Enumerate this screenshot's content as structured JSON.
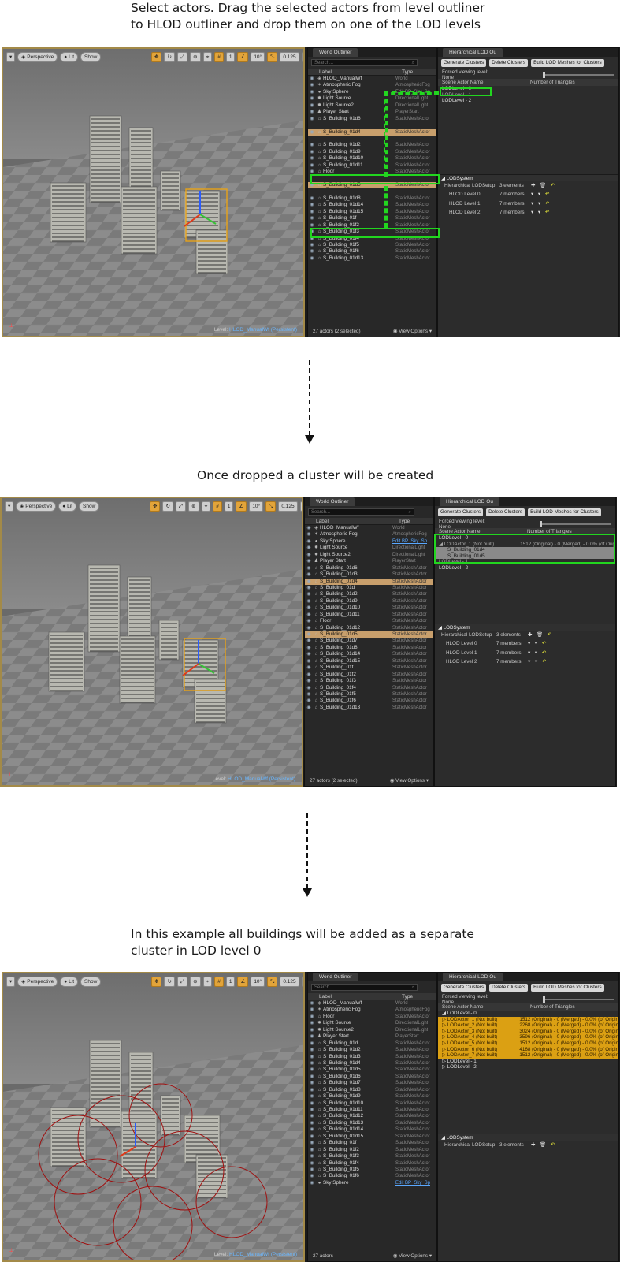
{
  "captions": {
    "step1_line1": "Select actors. Drag the selected actors from level outliner",
    "step1_line2": "to HLOD outliner and drop them on one of the LOD levels",
    "step2": "Once dropped a cluster will be created",
    "step3_line1": "In this example all buildings will be added as a separate",
    "step3_line2": "cluster in LOD level 0"
  },
  "viewport": {
    "perspective_label": "Perspective",
    "lit_label": "Lit",
    "show_label": "Show",
    "angle_value": "10°",
    "scale_value": "0.125",
    "camera_speed": "4",
    "level_prefix": "Level:",
    "level_name": "HLOD_ManualWf (Persistent)",
    "grid_value": "1"
  },
  "outliner": {
    "tab_title": "World Outliner",
    "search_placeholder": "Search...",
    "col_label": "Label",
    "col_type": "Type",
    "view_options": "View Options",
    "footer1": "27 actors (2 selected)",
    "footer2": "27 actors (2 selected)",
    "footer3": "27 actors",
    "rows1": [
      {
        "label": "HLOD_ManualWf",
        "type": "World",
        "icon": "◈",
        "sel": false
      },
      {
        "label": "Atmospheric Fog",
        "type": "AtmosphericFog",
        "icon": "✶",
        "sel": false
      },
      {
        "label": "Sky Sphere",
        "type": "Edit BP_Sky_Sp",
        "icon": "●",
        "sel": false
      },
      {
        "label": "Light Source",
        "type": "DirectionalLight",
        "icon": "✹",
        "sel": false
      },
      {
        "label": "Light Source2",
        "type": "DirectionalLight",
        "icon": "✹",
        "sel": false
      },
      {
        "label": "Player Start",
        "type": "PlayerStart",
        "icon": "♟",
        "sel": false
      },
      {
        "label": "S_Building_01d6",
        "type": "StaticMeshActor",
        "icon": "⌂",
        "sel": false
      },
      {
        "label": "",
        "type": "",
        "icon": "",
        "sel": false
      },
      {
        "label": "S_Building_01d4",
        "type": "StaticMeshActor",
        "icon": "⌂",
        "sel": true
      },
      {
        "label": "",
        "type": "",
        "icon": "",
        "sel": false
      },
      {
        "label": "S_Building_01d2",
        "type": "StaticMeshActor",
        "icon": "⌂",
        "sel": false
      },
      {
        "label": "S_Building_01d9",
        "type": "StaticMeshActor",
        "icon": "⌂",
        "sel": false
      },
      {
        "label": "S_Building_01d10",
        "type": "StaticMeshActor",
        "icon": "⌂",
        "sel": false
      },
      {
        "label": "S_Building_01d11",
        "type": "StaticMeshActor",
        "icon": "⌂",
        "sel": false
      },
      {
        "label": "Floor",
        "type": "StaticMeshActor",
        "icon": "⌂",
        "sel": false
      },
      {
        "label": "",
        "type": "",
        "icon": "",
        "sel": false
      },
      {
        "label": "S_Building_01d5",
        "type": "StaticMeshActor",
        "icon": "⌂",
        "sel": true
      },
      {
        "label": "",
        "type": "",
        "icon": "",
        "sel": false
      },
      {
        "label": "S_Building_01d8",
        "type": "StaticMeshActor",
        "icon": "⌂",
        "sel": false
      },
      {
        "label": "S_Building_01d14",
        "type": "StaticMeshActor",
        "icon": "⌂",
        "sel": false
      },
      {
        "label": "S_Building_01d15",
        "type": "StaticMeshActor",
        "icon": "⌂",
        "sel": false
      },
      {
        "label": "S_Building_01f",
        "type": "StaticMeshActor",
        "icon": "⌂",
        "sel": false
      },
      {
        "label": "S_Building_01f2",
        "type": "StaticMeshActor",
        "icon": "⌂",
        "sel": false
      },
      {
        "label": "S_Building_01f3",
        "type": "StaticMeshActor",
        "icon": "⌂",
        "sel": false
      },
      {
        "label": "S_Building_01f4",
        "type": "StaticMeshActor",
        "icon": "⌂",
        "sel": false
      },
      {
        "label": "S_Building_01f5",
        "type": "StaticMeshActor",
        "icon": "⌂",
        "sel": false
      },
      {
        "label": "S_Building_01f6",
        "type": "StaticMeshActor",
        "icon": "⌂",
        "sel": false
      },
      {
        "label": "S_Building_01d13",
        "type": "StaticMeshActor",
        "icon": "⌂",
        "sel": false
      }
    ],
    "rows2": [
      {
        "label": "HLOD_ManualWf",
        "type": "World",
        "icon": "◈",
        "sel": false
      },
      {
        "label": "Atmospheric Fog",
        "type": "AtmosphericFog",
        "icon": "✶",
        "sel": false
      },
      {
        "label": "Sky Sphere",
        "type": "Edit BP_Sky_Sp",
        "icon": "●",
        "sel": false,
        "link": true
      },
      {
        "label": "Light Source",
        "type": "DirectionalLight",
        "icon": "✹",
        "sel": false
      },
      {
        "label": "Light Source2",
        "type": "DirectionalLight",
        "icon": "✹",
        "sel": false
      },
      {
        "label": "Player Start",
        "type": "PlayerStart",
        "icon": "♟",
        "sel": false
      },
      {
        "label": "S_Building_01d6",
        "type": "StaticMeshActor",
        "icon": "⌂",
        "sel": false
      },
      {
        "label": "S_Building_01d3",
        "type": "StaticMeshActor",
        "icon": "⌂",
        "sel": false
      },
      {
        "label": "S_Building_01d4",
        "type": "StaticMeshActor",
        "icon": "⌂",
        "sel": true
      },
      {
        "label": "S_Building_01d",
        "type": "StaticMeshActor",
        "icon": "⌂",
        "sel": false
      },
      {
        "label": "S_Building_01d2",
        "type": "StaticMeshActor",
        "icon": "⌂",
        "sel": false
      },
      {
        "label": "S_Building_01d9",
        "type": "StaticMeshActor",
        "icon": "⌂",
        "sel": false
      },
      {
        "label": "S_Building_01d10",
        "type": "StaticMeshActor",
        "icon": "⌂",
        "sel": false
      },
      {
        "label": "S_Building_01d11",
        "type": "StaticMeshActor",
        "icon": "⌂",
        "sel": false
      },
      {
        "label": "Floor",
        "type": "StaticMeshActor",
        "icon": "⌂",
        "sel": false
      },
      {
        "label": "S_Building_01d12",
        "type": "StaticMeshActor",
        "icon": "⌂",
        "sel": false
      },
      {
        "label": "S_Building_01d5",
        "type": "StaticMeshActor",
        "icon": "⌂",
        "sel": true
      },
      {
        "label": "S_Building_01d7",
        "type": "StaticMeshActor",
        "icon": "⌂",
        "sel": false
      },
      {
        "label": "S_Building_01d8",
        "type": "StaticMeshActor",
        "icon": "⌂",
        "sel": false
      },
      {
        "label": "S_Building_01d14",
        "type": "StaticMeshActor",
        "icon": "⌂",
        "sel": false
      },
      {
        "label": "S_Building_01d15",
        "type": "StaticMeshActor",
        "icon": "⌂",
        "sel": false
      },
      {
        "label": "S_Building_01f",
        "type": "StaticMeshActor",
        "icon": "⌂",
        "sel": false
      },
      {
        "label": "S_Building_01f2",
        "type": "StaticMeshActor",
        "icon": "⌂",
        "sel": false
      },
      {
        "label": "S_Building_01f3",
        "type": "StaticMeshActor",
        "icon": "⌂",
        "sel": false
      },
      {
        "label": "S_Building_01f4",
        "type": "StaticMeshActor",
        "icon": "⌂",
        "sel": false
      },
      {
        "label": "S_Building_01f5",
        "type": "StaticMeshActor",
        "icon": "⌂",
        "sel": false
      },
      {
        "label": "S_Building_01f6",
        "type": "StaticMeshActor",
        "icon": "⌂",
        "sel": false
      },
      {
        "label": "S_Building_01d13",
        "type": "StaticMeshActor",
        "icon": "⌂",
        "sel": false
      }
    ],
    "rows3": [
      {
        "label": "HLOD_ManualWf",
        "type": "World",
        "icon": "◈",
        "sel": false
      },
      {
        "label": "Atmospheric Fog",
        "type": "AtmosphericFog",
        "icon": "✶",
        "sel": false
      },
      {
        "label": "Floor",
        "type": "StaticMeshActor",
        "icon": "⌂",
        "sel": false
      },
      {
        "label": "Light Source",
        "type": "DirectionalLight",
        "icon": "✹",
        "sel": false
      },
      {
        "label": "Light Source2",
        "type": "DirectionalLight",
        "icon": "✹",
        "sel": false
      },
      {
        "label": "Player Start",
        "type": "PlayerStart",
        "icon": "♟",
        "sel": false
      },
      {
        "label": "S_Building_01d",
        "type": "StaticMeshActor",
        "icon": "⌂",
        "sel": false
      },
      {
        "label": "S_Building_01d2",
        "type": "StaticMeshActor",
        "icon": "⌂",
        "sel": false
      },
      {
        "label": "S_Building_01d3",
        "type": "StaticMeshActor",
        "icon": "⌂",
        "sel": false
      },
      {
        "label": "S_Building_01d4",
        "type": "StaticMeshActor",
        "icon": "⌂",
        "sel": false
      },
      {
        "label": "S_Building_01d5",
        "type": "StaticMeshActor",
        "icon": "⌂",
        "sel": false
      },
      {
        "label": "S_Building_01d6",
        "type": "StaticMeshActor",
        "icon": "⌂",
        "sel": false
      },
      {
        "label": "S_Building_01d7",
        "type": "StaticMeshActor",
        "icon": "⌂",
        "sel": false
      },
      {
        "label": "S_Building_01d8",
        "type": "StaticMeshActor",
        "icon": "⌂",
        "sel": false
      },
      {
        "label": "S_Building_01d9",
        "type": "StaticMeshActor",
        "icon": "⌂",
        "sel": false
      },
      {
        "label": "S_Building_01d10",
        "type": "StaticMeshActor",
        "icon": "⌂",
        "sel": false
      },
      {
        "label": "S_Building_01d11",
        "type": "StaticMeshActor",
        "icon": "⌂",
        "sel": false
      },
      {
        "label": "S_Building_01d12",
        "type": "StaticMeshActor",
        "icon": "⌂",
        "sel": false
      },
      {
        "label": "S_Building_01d13",
        "type": "StaticMeshActor",
        "icon": "⌂",
        "sel": false
      },
      {
        "label": "S_Building_01d14",
        "type": "StaticMeshActor",
        "icon": "⌂",
        "sel": false
      },
      {
        "label": "S_Building_01d15",
        "type": "StaticMeshActor",
        "icon": "⌂",
        "sel": false
      },
      {
        "label": "S_Building_01f",
        "type": "StaticMeshActor",
        "icon": "⌂",
        "sel": false
      },
      {
        "label": "S_Building_01f2",
        "type": "StaticMeshActor",
        "icon": "⌂",
        "sel": false
      },
      {
        "label": "S_Building_01f3",
        "type": "StaticMeshActor",
        "icon": "⌂",
        "sel": false
      },
      {
        "label": "S_Building_01f4",
        "type": "StaticMeshActor",
        "icon": "⌂",
        "sel": false
      },
      {
        "label": "S_Building_01f5",
        "type": "StaticMeshActor",
        "icon": "⌂",
        "sel": false
      },
      {
        "label": "S_Building_01f6",
        "type": "StaticMeshActor",
        "icon": "⌂",
        "sel": false
      },
      {
        "label": "Sky Sphere",
        "type": "Edit BP_Sky_Sp",
        "icon": "●",
        "sel": false,
        "link": true
      }
    ]
  },
  "hlod": {
    "tab_title": "Hierarchical LOD Ou",
    "generate": "Generate Clusters",
    "delete": "Delete Clusters",
    "build": "Build LOD Meshes for Clusters",
    "forced": "Forced viewing level: None",
    "col_scene": "Scene Actor Name",
    "col_tris": "Number of Triangles",
    "tree1": [
      {
        "name": "LODLevel - 0",
        "tris": "",
        "style": ""
      },
      {
        "name": "LODLevel - 1",
        "tris": "",
        "style": "dim"
      },
      {
        "name": "LODLevel - 2",
        "tris": "",
        "style": ""
      }
    ],
    "tree2": [
      {
        "name": "LODLevel - 0",
        "tris": "",
        "style": ""
      },
      {
        "name": "◢ LODActor_1 (Not built)",
        "tris": "1512 (Original) - 0 (Merged) - 0.0% (of Orig",
        "style": "dim"
      },
      {
        "name": "S_Building_01d4",
        "tris": "",
        "style": "sub"
      },
      {
        "name": "S_Building_01d5",
        "tris": "",
        "style": "sub"
      },
      {
        "name": "LODLevel - 1",
        "tris": "",
        "style": "dim"
      },
      {
        "name": "LODLevel - 2",
        "tris": "",
        "style": ""
      }
    ],
    "tree3": [
      {
        "name": "◢ LODLevel - 0",
        "tris": "",
        "style": ""
      },
      {
        "name": "▷ LODActor_1 (Not built)",
        "tris": "1512 (Original) - 0 (Merged) - 0.0% (of Origin",
        "style": "gold"
      },
      {
        "name": "▷ LODActor_2 (Not built)",
        "tris": "2268 (Original) - 0 (Merged) - 0.0% (of Origin",
        "style": "gold"
      },
      {
        "name": "▷ LODActor_3 (Not built)",
        "tris": "3024 (Original) - 0 (Merged) - 0.0% (of Origin",
        "style": "gold"
      },
      {
        "name": "▷ LODActor_4 (Not built)",
        "tris": "3596 (Original) - 0 (Merged) - 0.0% (of Origin",
        "style": "gold"
      },
      {
        "name": "▷ LODActor_5 (Not built)",
        "tris": "1512 (Original) - 0 (Merged) - 0.0% (of Origin",
        "style": "gold"
      },
      {
        "name": "▷ LODActor_6 (Not built)",
        "tris": "4168 (Original) - 0 (Merged) - 0.0% (of Origin",
        "style": "gold"
      },
      {
        "name": "▷ LODActor_7 (Not built)",
        "tris": "1512 (Original) - 0 (Merged) - 0.0% (of Origin",
        "style": "gold"
      },
      {
        "name": "▷ LODLevel - 1",
        "tris": "",
        "style": ""
      },
      {
        "name": "▷ LODLevel - 2",
        "tris": "",
        "style": ""
      }
    ],
    "lodsystem": "LODSystem",
    "setup": "Hierarchical LODSetup",
    "elements": "3 elements",
    "levels": [
      {
        "name": "HLOD Level 0",
        "members": "7 members"
      },
      {
        "name": "HLOD Level 1",
        "members": "7 members"
      },
      {
        "name": "HLOD Level 2",
        "members": "7 members"
      }
    ]
  },
  "colors": {
    "highlight": "#22d61f",
    "selection": "#c89f6c",
    "cluster": "#dba013"
  }
}
